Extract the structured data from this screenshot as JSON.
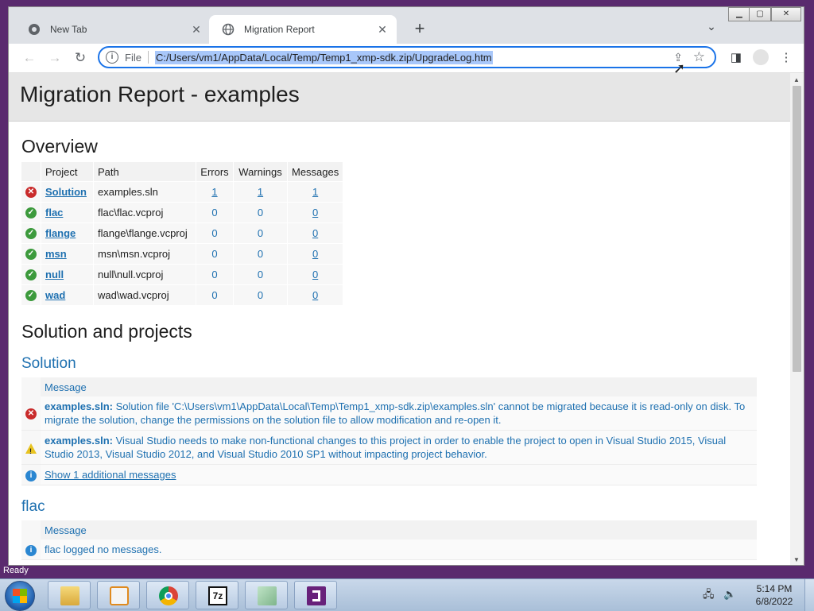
{
  "browser": {
    "tabs": [
      {
        "title": "New Tab",
        "active": false,
        "favicon": "chrome-icon"
      },
      {
        "title": "Migration Report",
        "active": true,
        "favicon": "globe-icon"
      }
    ],
    "address": {
      "scheme_label": "File",
      "url": "C:/Users/vm1/AppData/Local/Temp/Temp1_xmp-sdk.zip/UpgradeLog.htm"
    }
  },
  "report": {
    "title": "Migration Report - examples",
    "overview": {
      "heading": "Overview",
      "columns": [
        "Project",
        "Path",
        "Errors",
        "Warnings",
        "Messages"
      ],
      "rows": [
        {
          "status": "error",
          "project": "Solution",
          "path": "examples.sln",
          "errors": "1",
          "warnings": "1",
          "messages": "1"
        },
        {
          "status": "ok",
          "project": "flac",
          "path": "flac\\flac.vcproj",
          "errors": "0",
          "warnings": "0",
          "messages": "0"
        },
        {
          "status": "ok",
          "project": "flange",
          "path": "flange\\flange.vcproj",
          "errors": "0",
          "warnings": "0",
          "messages": "0"
        },
        {
          "status": "ok",
          "project": "msn",
          "path": "msn\\msn.vcproj",
          "errors": "0",
          "warnings": "0",
          "messages": "0"
        },
        {
          "status": "ok",
          "project": "null",
          "path": "null\\null.vcproj",
          "errors": "0",
          "warnings": "0",
          "messages": "0"
        },
        {
          "status": "ok",
          "project": "wad",
          "path": "wad\\wad.vcproj",
          "errors": "0",
          "warnings": "0",
          "messages": "0"
        }
      ]
    },
    "solution_heading": "Solution and projects",
    "sections": [
      {
        "name": "Solution",
        "column": "Message",
        "messages": [
          {
            "type": "error",
            "source": "examples.sln:",
            "text": "Solution file 'C:\\Users\\vm1\\AppData\\Local\\Temp\\Temp1_xmp-sdk.zip\\examples.sln' cannot be migrated because it is read-only on disk. To migrate the solution, change the permissions on the solution file to allow modification and re-open it."
          },
          {
            "type": "warning",
            "source": "examples.sln:",
            "text": "Visual Studio needs to make non-functional changes to this project in order to enable the project to open in Visual Studio 2015, Visual Studio 2013, Visual Studio 2012, and Visual Studio 2010 SP1 without impacting project behavior."
          },
          {
            "type": "info",
            "source": "",
            "text": "Show 1 additional messages"
          }
        ]
      },
      {
        "name": "flac",
        "column": "Message",
        "messages": [
          {
            "type": "info",
            "source": "",
            "text": "flac logged no messages."
          }
        ]
      }
    ]
  },
  "status_text": "Ready",
  "taskbar": {
    "apps": [
      "folder-icon",
      "media-player-icon",
      "chrome-icon",
      "7zip-icon",
      "notepad-icon",
      "visual-studio-icon"
    ],
    "time": "5:14 PM",
    "date": "6/8/2022"
  }
}
